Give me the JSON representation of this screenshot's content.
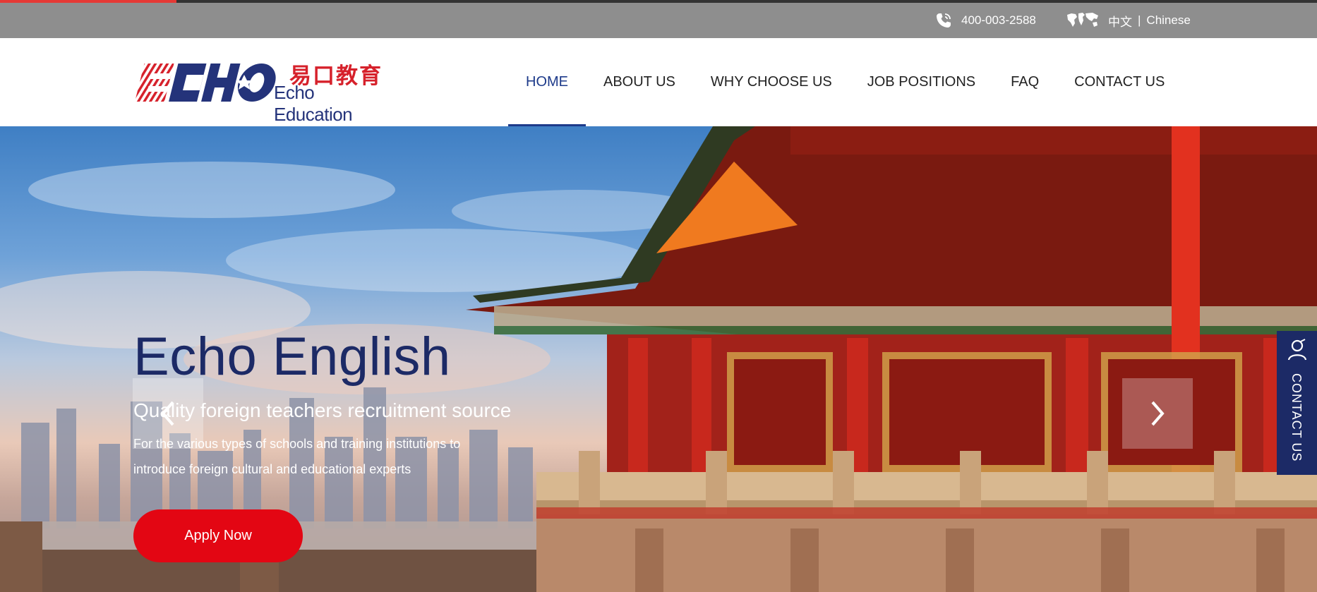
{
  "utility_bar": {
    "phone": "400-003-2588",
    "phone_icon": "phone-icon",
    "globe_icon": "world-map-icon",
    "lang_cn": "中文",
    "lang_sep": "|",
    "lang_en": "Chinese"
  },
  "logo": {
    "mark": "ECHO",
    "cn": "易口教育",
    "en": "Echo Education"
  },
  "nav": {
    "items": [
      {
        "label": "HOME",
        "active": true
      },
      {
        "label": "ABOUT US"
      },
      {
        "label": "WHY CHOOSE US"
      },
      {
        "label": "JOB POSITIONS"
      },
      {
        "label": "FAQ"
      },
      {
        "label": "CONTACT US"
      }
    ]
  },
  "hero": {
    "title": "Echo English",
    "subtitle": "Quality foreign teachers recruitment source",
    "desc_line1": "For the various types of schools and training institutions to",
    "desc_line2": "introduce foreign cultural and educational experts",
    "button": "Apply Now",
    "prev_icon": "chevron-left-icon",
    "next_icon": "chevron-right-icon"
  },
  "side_tab": {
    "label": "CONTACT US",
    "icon": "person-icon"
  },
  "colors": {
    "accent_red": "#e30613",
    "navy": "#1c2a66",
    "nav_active": "#1d3a8a",
    "utility_gray": "#8e8e8e"
  }
}
